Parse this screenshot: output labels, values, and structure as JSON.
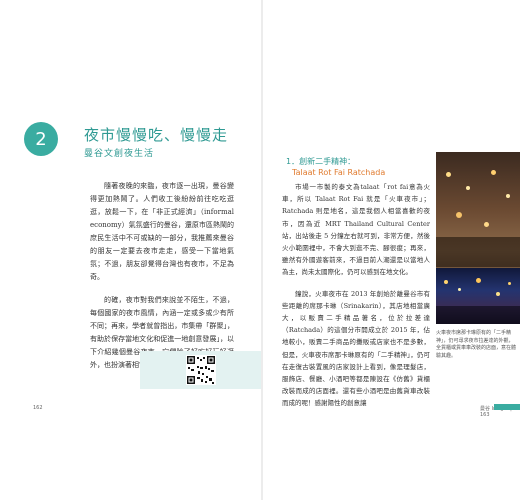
{
  "chapter": {
    "number": "2",
    "title": "夜市慢慢吃、慢慢走",
    "subtitle": "曼谷文創夜生活"
  },
  "left_page": {
    "paragraphs": [
      "隨著夜晚的來臨，夜市逐一出現，曼谷變得更加熱鬧了。人們收工後紛紛前往吃吃逛逛，放鬆一下，在「非正式經濟」（informal economy）氣氛盛行的曼谷，還原市區熱鬧的庶民生活中不可或缺的一部分，我推薦來曼谷的朋友一定要去夜市走走，感受一下當地氣氛；不過，朋友卻覺得台灣也有夜市，不足為奇。",
      "的確，夜市對我們來說並不陌生，不過，每個國家的夜市風情，內涵一定或多或少有所不同；再來，學者就曾指出，市集帶「群聚」，有助於保存當地文化和促進一地創意發展」，以下介紹幾個曼谷夜市，它們除了好吃好玩好逛外，也扮演著相當重要的「文化角色」。"
    ],
    "page_number": "162"
  },
  "right_page": {
    "section_title": "1．創新二手精神：",
    "section_subtitle": "Talaat Rot Fai Ratchada",
    "paragraphs": [
      "市場一市製的泰文為talaat「rot fai意為火車，所以 Talaat Rot Fai 就是「火車夜市」；Ratchada 則是地名，這是我個人相當喜歡的夜市，因為近 MRT Thailand Cultural Center 站，出站後走 5 分鐘左右就可到，非常方便，然後火小範圍裡中，不會大到逛不完、腳很痠；再來，雖然有外國遊客前來，不過目前人潮還是以當地人為主，尚未太國際化，仍可以感到在地文化。",
      "鐘說，火車夜市在 2013 年創始於離曼谷市有些距離的席那卡琳（Srinakarin），其店地相當廣大，以販賣二手精品著名，位於拉差達（Ratchada）的這個分市開成立於 2015 年，佔地較小，販賣二手商品的攤販或店家也不是多數，但是，火車夜市席那卡琳原有的「二手精神」，仍可在走復古裝置風的店家設計上看到，像是理髮店，服飾店、餐廳、小酒吧等都是陳設在《仿舊》貨櫃改裝而成的店面裡。還有些小酒吧是由舊貨車改裝而成的呢！感謝陽性的創意讓"
    ],
    "caption": "火車夜市席那卡琳原有的「二手精神」，仍可尋求夜市拉差達的外觀，全貨櫃或貨車車改裝的店面，意在體驗其趣。",
    "footer_text": "曼谷 Insight",
    "page_number": "163"
  },
  "colors": {
    "accent": "#3aaca1",
    "title": "#2f9a93",
    "subtitle_orange": "#e07b2f"
  }
}
